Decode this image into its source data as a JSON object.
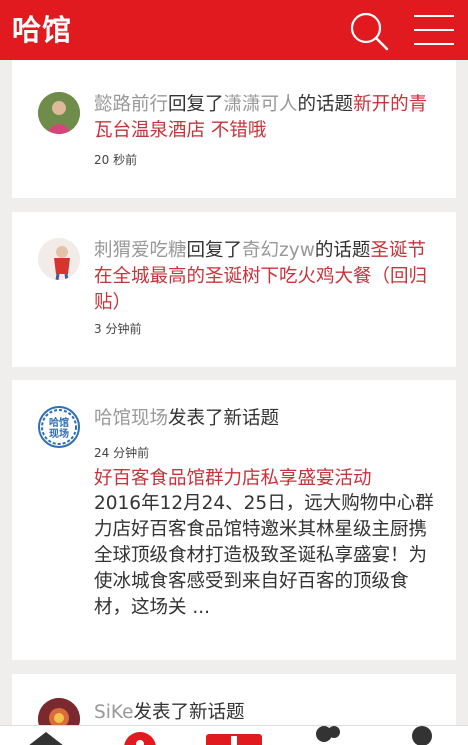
{
  "app": {
    "logo": "哈馆"
  },
  "header": {
    "search_icon": "search-icon",
    "menu_icon": "menu-icon"
  },
  "feed": [
    {
      "user": "懿路前行",
      "action": "回复了",
      "target_user": "潇潇可人",
      "connector": "的话题",
      "topic": "新开的青瓦台温泉酒店 不错哦",
      "time": "20 秒前"
    },
    {
      "user": "刺猬爱吃糖",
      "action": "回复了",
      "target_user": "奇幻zyw",
      "connector": "的话题",
      "topic": "圣诞节在全城最高的圣诞树下吃火鸡大餐（回归贴）",
      "time": "3 分钟前"
    },
    {
      "user": "哈馆现场",
      "action": "发表了新话题",
      "time": "24 分钟前",
      "topic": "好百客食品馆群力店私享盛宴活动",
      "excerpt": "2016年12月24、25日，远大购物中心群力店好百客食品馆特邀米其林星级主厨携全球顶级食材打造极致圣诞私享盛宴！为使冰城食客感受到来自好百客的顶级食材，这场关 ..."
    },
    {
      "user": "SiKe",
      "action": "发表了新话题"
    }
  ],
  "bottom_nav": {
    "items": [
      "home-icon",
      "discover-icon",
      "post-icon",
      "friends-icon",
      "profile-icon"
    ],
    "accent": "#e01a1f"
  },
  "colors": {
    "brand": "#e01a1f",
    "link": "#c9333b",
    "username": "#999999"
  }
}
